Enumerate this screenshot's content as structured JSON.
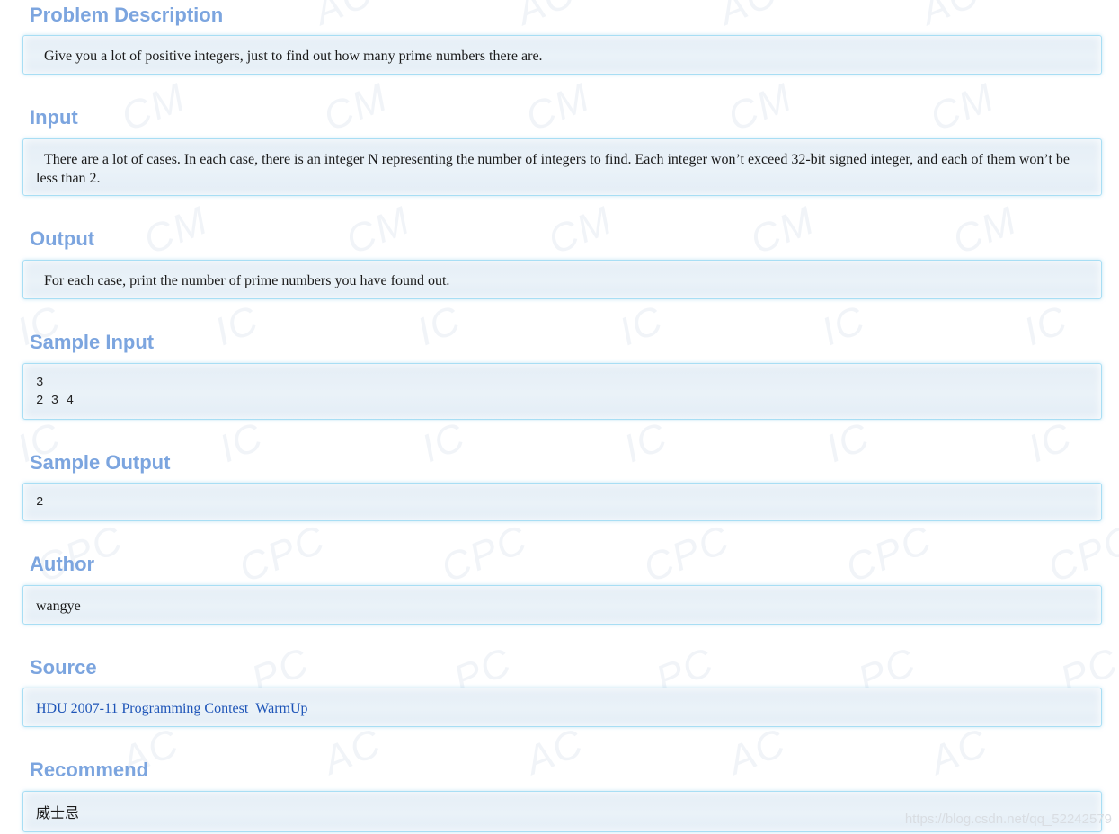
{
  "sections": {
    "description": {
      "heading": "Problem Description",
      "text": "Give you a lot of positive integers, just to find out how many prime numbers there are."
    },
    "input": {
      "heading": "Input",
      "text": "There are a lot of cases. In each case, there is an integer N representing the number of integers to find. Each integer won’t exceed 32-bit signed integer, and each of them won’t be less than 2."
    },
    "output": {
      "heading": "Output",
      "text": "For each case, print the number of prime numbers you have found out."
    },
    "sample_input": {
      "heading": "Sample Input",
      "lines": [
        "3",
        "2 3 4"
      ]
    },
    "sample_output": {
      "heading": "Sample Output",
      "lines": [
        "2"
      ]
    },
    "author": {
      "heading": "Author",
      "text": "wangye"
    },
    "source": {
      "heading": "Source",
      "link_text": "HDU 2007-11 Programming Contest_WarmUp"
    },
    "recommend": {
      "heading": "Recommend",
      "text": "威士忌"
    }
  },
  "background_watermark": {
    "tokens": [
      "ACM",
      "ICPC"
    ]
  },
  "csdn_watermark": "https://blog.csdn.net/qq_52242579",
  "colors": {
    "heading": "#7ca5df",
    "panel_border": "#a8def4",
    "panel_bg": "#e8f0f7",
    "link": "#1e55b8"
  }
}
